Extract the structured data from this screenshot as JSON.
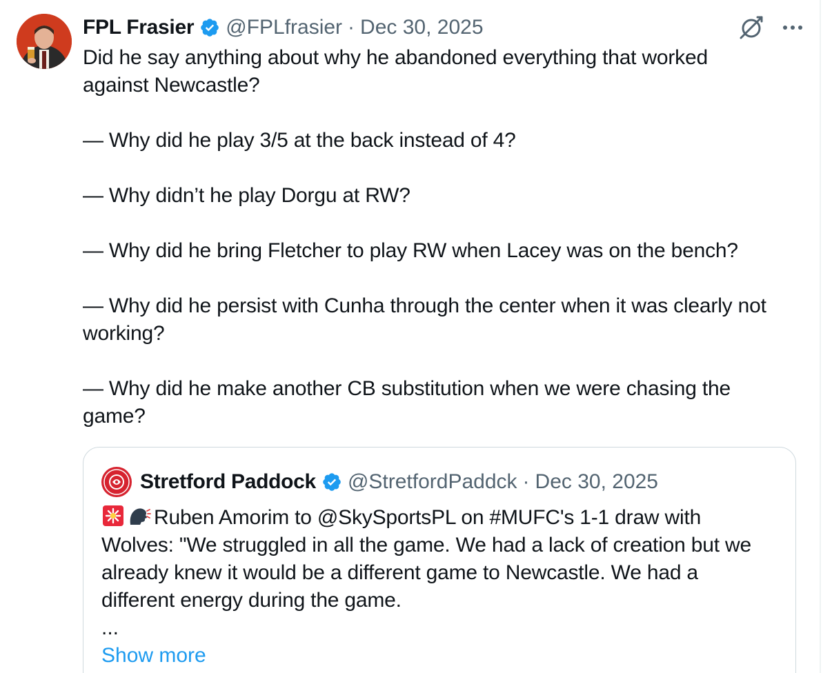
{
  "tweet": {
    "author": {
      "name": "FPL Frasier",
      "handle": "@FPLfrasier",
      "verified": true
    },
    "separator": "·",
    "date": "Dec 30, 2025",
    "icons": {
      "verified": "verified-badge-icon",
      "grok": "grok-icon",
      "more": "more-icon"
    },
    "text_lines": [
      "Did he say anything about why he abandoned everything that worked",
      "against Newcastle?",
      "",
      "— Why did he play 3/5 at the back instead of 4?",
      "",
      "— Why didn’t he play Dorgu at RW?",
      "",
      "— Why did he bring Fletcher to play RW when Lacey was on the bench?",
      "",
      "— Why did he persist with Cunha through the center when it was clearly not",
      "working?",
      "",
      "— Why did he make another CB substitution when we were chasing the",
      "game?"
    ]
  },
  "quote": {
    "author": {
      "name": "Stretford Paddock",
      "handle": "@StretfordPaddck",
      "verified": true
    },
    "separator": "·",
    "date": "Dec 30, 2025",
    "emojis": [
      "siren-emoji",
      "speaking-head-emoji"
    ],
    "line1": "Ruben Amorim to @SkySportsPL on #MUFC's 1-1 draw with",
    "line2": "Wolves: \"We struggled in all the game. We had a lack of creation but we",
    "line3": "already knew it would be a different game to Newcastle. We had a",
    "line4": "different energy during the game.",
    "ellipsis": "...",
    "show_more": "Show more"
  },
  "colors": {
    "text": "#0f1419",
    "secondary": "#536471",
    "link": "#1d9bf0",
    "border": "#cfd9de",
    "verified": "#1d9bf0"
  }
}
